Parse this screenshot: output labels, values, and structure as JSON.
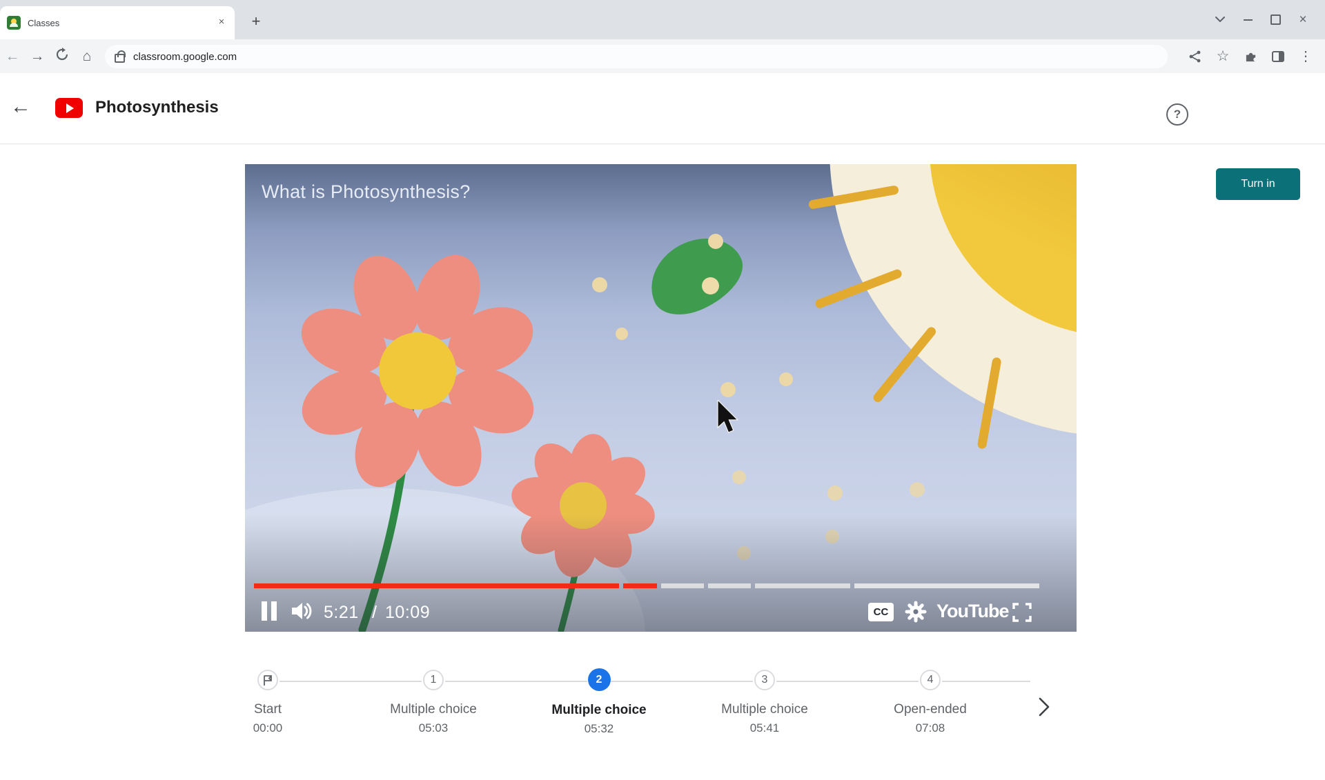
{
  "browser": {
    "tab_title": "Classes",
    "url": "classroom.google.com",
    "glyphs": {
      "back": "←",
      "forward": "→",
      "home": "⌂",
      "star": "☆",
      "plus": "+",
      "close_tab": "×",
      "close_window": "×",
      "menu_dots": "⋮",
      "question": "?"
    }
  },
  "header": {
    "title": "Photosynthesis",
    "turn_in_label": "Turn in"
  },
  "video": {
    "overlay_title": "What is Photosynthesis?",
    "current_time": "5:21",
    "duration_separator": "/",
    "duration": "10:09",
    "cc_label": "CC",
    "youtube_wordmark": "YouTube"
  },
  "timeline": {
    "items": [
      {
        "marker": "flag",
        "label": "Start",
        "time": "00:00"
      },
      {
        "marker": "1",
        "label": "Multiple choice",
        "time": "05:03"
      },
      {
        "marker": "2",
        "label": "Multiple choice",
        "time": "05:32"
      },
      {
        "marker": "3",
        "label": "Multiple choice",
        "time": "05:41"
      },
      {
        "marker": "4",
        "label": "Open-ended",
        "time": "07:08"
      }
    ]
  },
  "colors": {
    "accent_blue": "#1a73e8",
    "turn_in_teal": "#0b7077",
    "progress_red": "#f22b18",
    "youtube_red": "#f00000",
    "petal_coral": "#ee8e80",
    "sun_gold": "#eec33a"
  }
}
